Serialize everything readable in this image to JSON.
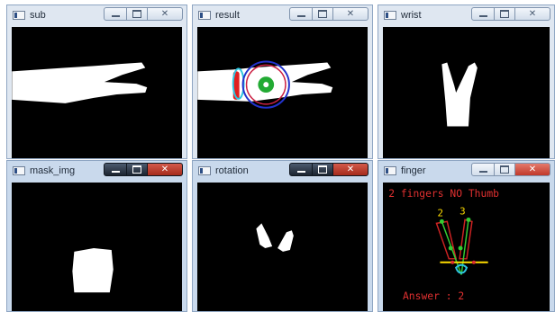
{
  "windows": {
    "sub": {
      "title": "sub"
    },
    "result": {
      "title": "result"
    },
    "wrist": {
      "title": "wrist"
    },
    "mask_img": {
      "title": "mask_img"
    },
    "rotation": {
      "title": "rotation"
    },
    "finger": {
      "title": "finger",
      "status_text": "2 fingers NO Thumb",
      "finger_labels": [
        "2",
        "3"
      ],
      "answer_text": "Answer : 2"
    }
  },
  "colors": {
    "frame": "#c9d9ec",
    "image_background": "#000000",
    "hand": "#ffffff",
    "finger_text": "#e03030",
    "contour": "#cc2222",
    "fingertip_point": "#33cc33",
    "palm_line": "#ffdd00",
    "wrist_marker": "#2ec6e0",
    "circle": "#2233cc"
  },
  "icons": [
    "app-window-icon",
    "minimize-icon",
    "maximize-icon",
    "close-icon"
  ]
}
